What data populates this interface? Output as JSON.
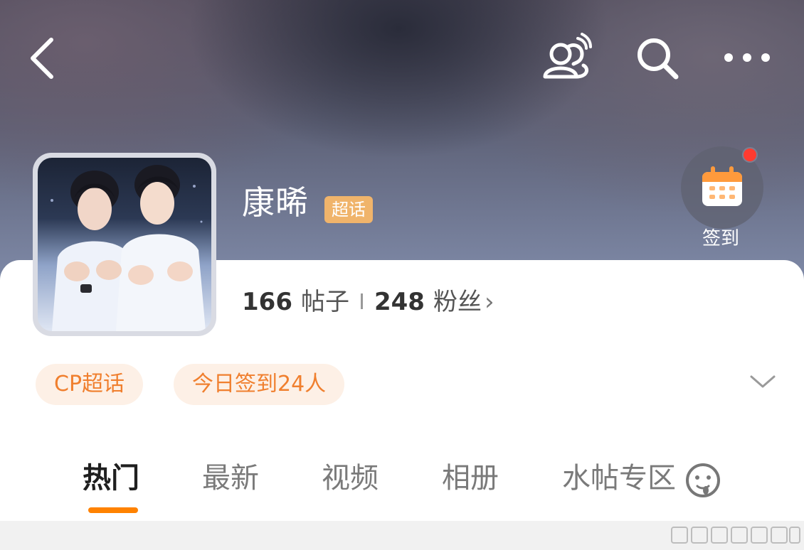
{
  "header": {
    "icons": [
      "back-icon",
      "chat-icon",
      "search-icon",
      "more-icon"
    ]
  },
  "profile": {
    "name": "康晞",
    "badge": "超话",
    "posts_count": "166",
    "posts_label": "帖子",
    "fans_count": "248",
    "fans_label": "粉丝",
    "fans_chevron": "›"
  },
  "checkin": {
    "label": "签到",
    "icon": "calendar-icon",
    "notification_color": "#ff3b30"
  },
  "chips": [
    {
      "label": "CP超话"
    },
    {
      "label": "今日签到24人"
    }
  ],
  "tabs": [
    {
      "label": "热门",
      "active": true
    },
    {
      "label": "最新",
      "active": false
    },
    {
      "label": "视频",
      "active": false
    },
    {
      "label": "相册",
      "active": false
    },
    {
      "label": "水帖专区",
      "active": false
    }
  ],
  "colors": {
    "accent": "#ff8200",
    "chip_text": "#f07f2e",
    "chip_bg": "#fdf0e6",
    "badge_bg": "#f0b46b"
  }
}
